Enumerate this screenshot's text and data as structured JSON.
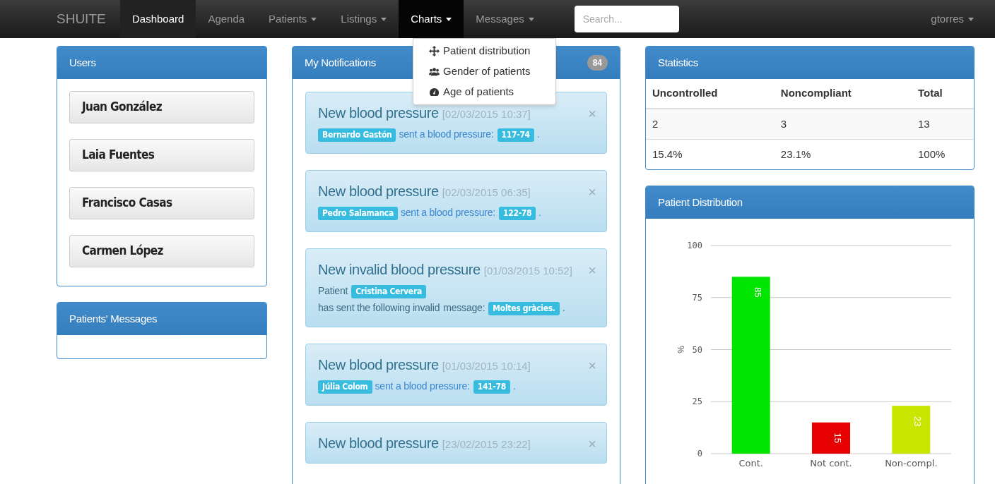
{
  "navbar": {
    "brand": "SHUITE",
    "items": [
      {
        "label": "Dashboard",
        "selected": true,
        "caret": false,
        "open": false
      },
      {
        "label": "Agenda",
        "selected": false,
        "caret": false,
        "open": false
      },
      {
        "label": "Patients",
        "selected": false,
        "caret": true,
        "open": false
      },
      {
        "label": "Listings",
        "selected": false,
        "caret": true,
        "open": false
      },
      {
        "label": "Charts",
        "selected": false,
        "caret": true,
        "open": true
      },
      {
        "label": "Messages",
        "selected": false,
        "caret": true,
        "open": false
      }
    ],
    "search": {
      "placeholder": "Search..."
    },
    "user": "gtorres"
  },
  "charts_menu": [
    {
      "kind": "move",
      "label": "Patient distribution"
    },
    {
      "kind": "users",
      "label": "Gender of patients"
    },
    {
      "kind": "dashboard",
      "label": "Age of patients"
    }
  ],
  "users_panel": {
    "title": "Users",
    "users": [
      "Juan González",
      "Laia Fuentes",
      "Francisco Casas",
      "Carmen López"
    ]
  },
  "messages_panel": {
    "title": "Patients' Messages"
  },
  "notifications": {
    "title": "My Notifications",
    "count": "84",
    "items": [
      {
        "title": "New blood pressure",
        "time": "[02/03/2015 10:37]",
        "close": "×",
        "body": [
          {
            "kind": "label",
            "text": "Bernardo Gastón"
          },
          {
            "kind": "link",
            "text": "sent a blood pressure:"
          },
          {
            "kind": "label",
            "text": "117-74"
          },
          {
            "kind": "link",
            "text": "."
          }
        ]
      },
      {
        "title": "New blood pressure",
        "time": "[02/03/2015 06:35]",
        "close": "×",
        "body": [
          {
            "kind": "label",
            "text": "Pedro Salamanca"
          },
          {
            "kind": "link",
            "text": "sent a blood pressure:"
          },
          {
            "kind": "label",
            "text": "122-78"
          },
          {
            "kind": "link",
            "text": "."
          }
        ]
      },
      {
        "title": "New invalid blood pressure",
        "time": "[01/03/2015 10:52]",
        "close": "×",
        "body": [
          {
            "kind": "text",
            "text": "Patient"
          },
          {
            "kind": "label",
            "text": "Cristina Cervera"
          },
          {
            "kind": "text",
            "text": "has sent the following invalid"
          },
          {
            "kind": "text",
            "text": "message:"
          },
          {
            "kind": "label",
            "text": "Moltes gràcies."
          },
          {
            "kind": "text",
            "text": "."
          }
        ]
      },
      {
        "title": "New blood pressure",
        "time": "[01/03/2015 10:14]",
        "close": "×",
        "body": [
          {
            "kind": "label",
            "text": "Júlia Colom"
          },
          {
            "kind": "link",
            "text": "sent a blood pressure:"
          },
          {
            "kind": "label",
            "text": "141-78"
          },
          {
            "kind": "link",
            "text": "."
          }
        ]
      },
      {
        "title": "New blood pressure",
        "time": "[23/02/2015 23:22]",
        "close": "×"
      }
    ]
  },
  "statistics": {
    "title": "Statistics",
    "columns": [
      "Uncontrolled",
      "Noncompliant",
      "Total"
    ],
    "rows": [
      [
        "2",
        "3",
        "13"
      ],
      [
        "15.4%",
        "23.1%",
        "100%"
      ]
    ]
  },
  "distribution": {
    "title": "Patient Distribution",
    "chart_data": {
      "type": "bar",
      "ylabel": "%",
      "categories": [
        "Cont.",
        "Not cont.",
        "Non-compl."
      ],
      "stacked": true,
      "ylim": [
        0,
        100
      ],
      "yticks": [
        0,
        25,
        50,
        75,
        100
      ],
      "data_labels": true,
      "grid": true,
      "series": [
        {
          "color": "#00e600",
          "values": [
            85,
            null,
            null
          ]
        },
        {
          "color": "#e60000",
          "values": [
            null,
            15,
            null
          ]
        },
        {
          "color": "#c8e600",
          "values": [
            null,
            null,
            23
          ]
        }
      ]
    }
  }
}
